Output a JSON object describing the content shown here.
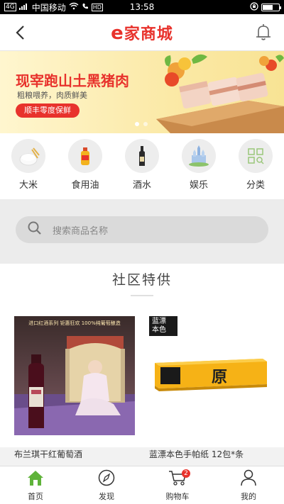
{
  "status_bar": {
    "signal_label": "4G",
    "carrier": "中国移动",
    "hd_label": "HD",
    "time": "13:58"
  },
  "navbar": {
    "brand_e": "e",
    "brand_text": "家商城",
    "back_icon": "back-arrow-icon",
    "bell_icon": "bell-icon"
  },
  "banner": {
    "title": "现宰跑山土黑猪肉",
    "subtitle": "粗粮喂养，肉质鲜美",
    "badge": "顺丰零度保鲜",
    "brand_color": "#e8322c"
  },
  "categories": [
    {
      "label": "大米",
      "icon": "rice-icon"
    },
    {
      "label": "食用油",
      "icon": "oil-bottle-icon"
    },
    {
      "label": "酒水",
      "icon": "wine-bottle-icon"
    },
    {
      "label": "娱乐",
      "icon": "castle-icon"
    },
    {
      "label": "分类",
      "icon": "grid-category-icon"
    }
  ],
  "search": {
    "placeholder": "搜索商品名称"
  },
  "section": {
    "title": "社区特供"
  },
  "products": [
    {
      "name": "布兰琪干红葡萄酒",
      "image_caption": "进口红酒系列 钜惠狂欢 100%纯葡萄酿造"
    },
    {
      "name": "蓝漂本色手帕纸 12包*条",
      "image_logo": "蓝漂\n本色",
      "box_mark": "原"
    }
  ],
  "tabbar": [
    {
      "label": "首页",
      "icon": "home-icon",
      "active": true
    },
    {
      "label": "发现",
      "icon": "compass-icon"
    },
    {
      "label": "购物车",
      "icon": "cart-icon",
      "badge": "2"
    },
    {
      "label": "我的",
      "icon": "user-icon"
    }
  ]
}
